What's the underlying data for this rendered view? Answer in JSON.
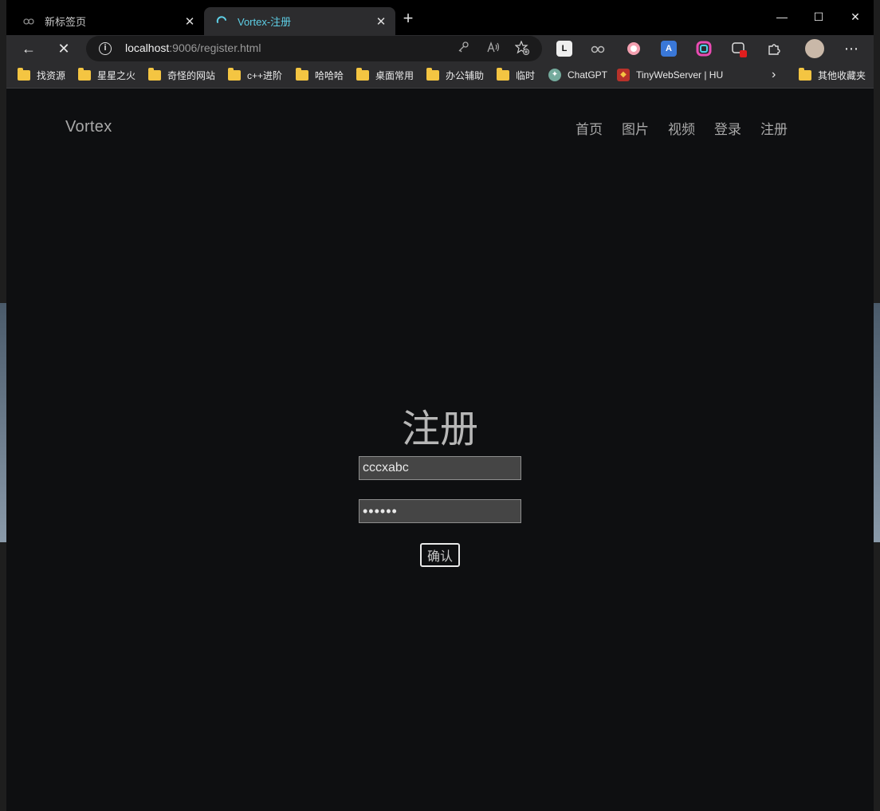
{
  "tabs": [
    {
      "title": "新标签页",
      "close": "✕"
    },
    {
      "title": "Vortex-注册",
      "close": "✕"
    }
  ],
  "new_tab_glyph": "+",
  "window_controls": {
    "minimize": "—",
    "maximize": "☐",
    "close": "✕"
  },
  "toolbar": {
    "back_glyph": "←",
    "stop_glyph": "✕",
    "url_host": "localhost",
    "url_rest": ":9006/register.html",
    "more_glyph": "⋯"
  },
  "bookmarks": [
    {
      "label": "找资源",
      "icon": "folder-icon"
    },
    {
      "label": "星星之火",
      "icon": "folder-icon"
    },
    {
      "label": "奇怪的网站",
      "icon": "folder-icon"
    },
    {
      "label": "c++进阶",
      "icon": "folder-icon"
    },
    {
      "label": "哈哈哈",
      "icon": "folder-icon"
    },
    {
      "label": "桌面常用",
      "icon": "folder-icon"
    },
    {
      "label": "办公辅助",
      "icon": "folder-icon"
    },
    {
      "label": "临时",
      "icon": "folder-icon"
    },
    {
      "label": "ChatGPT",
      "icon": "chatgpt-icon"
    },
    {
      "label": "TinyWebServer | HU",
      "icon": "ironman-icon"
    }
  ],
  "bookmarks_overflow_glyph": "›",
  "other_bookmarks": "其他收藏夹",
  "page": {
    "brand": "Vortex",
    "nav": [
      "首页",
      "图片",
      "视频",
      "登录",
      "注册"
    ],
    "title": "注册",
    "username_value": "cccxabc",
    "password_value": "••••••",
    "confirm_label": "确认"
  },
  "colors": {
    "page_bg": "#0e0f11",
    "active_tab_text": "#5ecfe6",
    "chrome_bg": "#2c2c2e"
  }
}
